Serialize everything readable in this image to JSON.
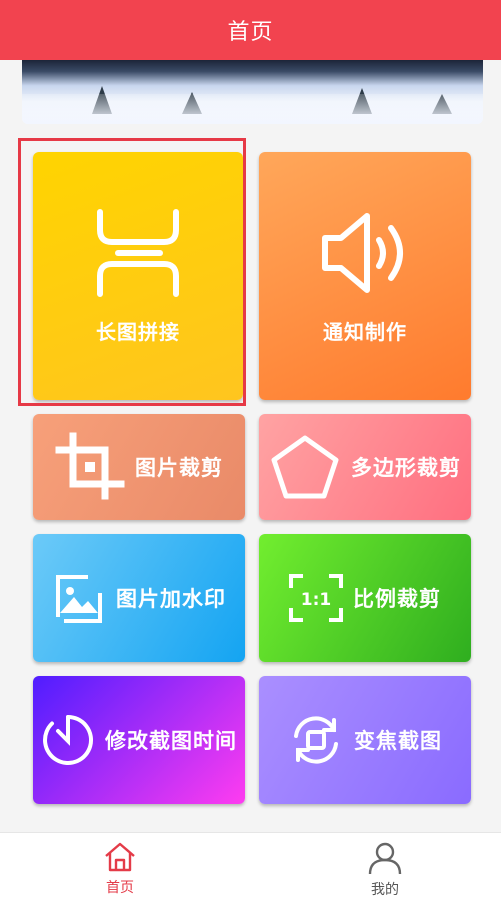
{
  "header": {
    "title": "首页"
  },
  "banner": {
    "alt_icon": "snow-landscape"
  },
  "tiles": {
    "long_stitch": {
      "label": "长图拼接",
      "icon": "stitch-icon",
      "colors": [
        "#ffd400",
        "#ffc21e"
      ]
    },
    "notification": {
      "label": "通知制作",
      "icon": "speaker-icon",
      "colors": [
        "#ff9a4a",
        "#ff7a2d"
      ]
    },
    "crop": {
      "label": "图片裁剪",
      "icon": "crop-icon",
      "colors": [
        "#f59472",
        "#e88b6c"
      ]
    },
    "polygon_crop": {
      "label": "多边形裁剪",
      "icon": "pentagon-icon",
      "colors": [
        "#ff9e9e",
        "#ff6f82"
      ]
    },
    "watermark": {
      "label": "图片加水印",
      "icon": "image-icon",
      "colors": [
        "#4cbcf7",
        "#1aa7f3"
      ]
    },
    "ratio_crop": {
      "label": "比例裁剪",
      "icon": "ratio-icon",
      "ratio_text": "1:1",
      "colors": [
        "#6ef02b",
        "#2fb51e"
      ]
    },
    "edit_time": {
      "label": "修改截图时间",
      "icon": "timer-icon",
      "colors": [
        "#5b20ff",
        "#ff35e8"
      ]
    },
    "zoom_shot": {
      "label": "变焦截图",
      "icon": "zoom-rotate-icon",
      "colors": [
        "#a98bff",
        "#8c6dff"
      ]
    }
  },
  "tabbar": {
    "home": {
      "label": "首页",
      "active": true,
      "color": "#e43b48"
    },
    "mine": {
      "label": "我的",
      "active": false,
      "color": "#555555"
    }
  }
}
